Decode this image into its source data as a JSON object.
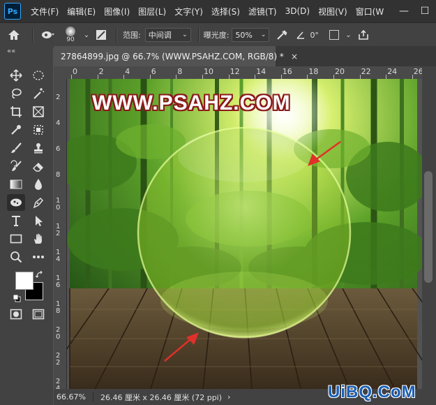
{
  "menubar": {
    "logo": "Ps",
    "items": [
      "文件(F)",
      "编辑(E)",
      "图像(I)",
      "图层(L)",
      "文字(Y)",
      "选择(S)",
      "滤镜(T)",
      "3D(D)",
      "视图(V)",
      "窗口(W"
    ],
    "minimize": "—",
    "maximize": "☐"
  },
  "options_bar": {
    "brush_size": "90",
    "range_label": "范围:",
    "range_value": "中间调",
    "exposure_label": "曝光度:",
    "exposure_value": "50%",
    "angle_value": "0°"
  },
  "tools": {
    "collapse": "««"
  },
  "document_tab": {
    "title": "27864899.jpg @ 66.7% (WWW.PSAHZ.COM, RGB/8) *",
    "close": "×"
  },
  "ruler_top": [
    "0",
    "2",
    "4",
    "6",
    "8",
    "10",
    "12",
    "14",
    "16",
    "18",
    "20",
    "22",
    "24",
    "26"
  ],
  "ruler_left": [
    "2",
    "4",
    "6",
    "8",
    "1\n0",
    "1\n2",
    "1\n4",
    "1\n6",
    "1\n8",
    "2\n0",
    "2\n2",
    "2\n4"
  ],
  "canvas": {
    "watermark": "WWW.PSAHZ.COM"
  },
  "status": {
    "zoom": "66.67%",
    "info": "26.46 厘米 x 26.46 厘米 (72 ppi)",
    "arrow": "›"
  },
  "corner_logo": "UiBQ.CoM",
  "colors": {
    "menubar": "#323232",
    "panel": "#424242",
    "workspace": "#535353",
    "watermark_fill": "#ffffff",
    "watermark_stroke": "#8a1a1a",
    "arrow_red": "#e0302a",
    "corner_logo": "#1a5fb4"
  }
}
